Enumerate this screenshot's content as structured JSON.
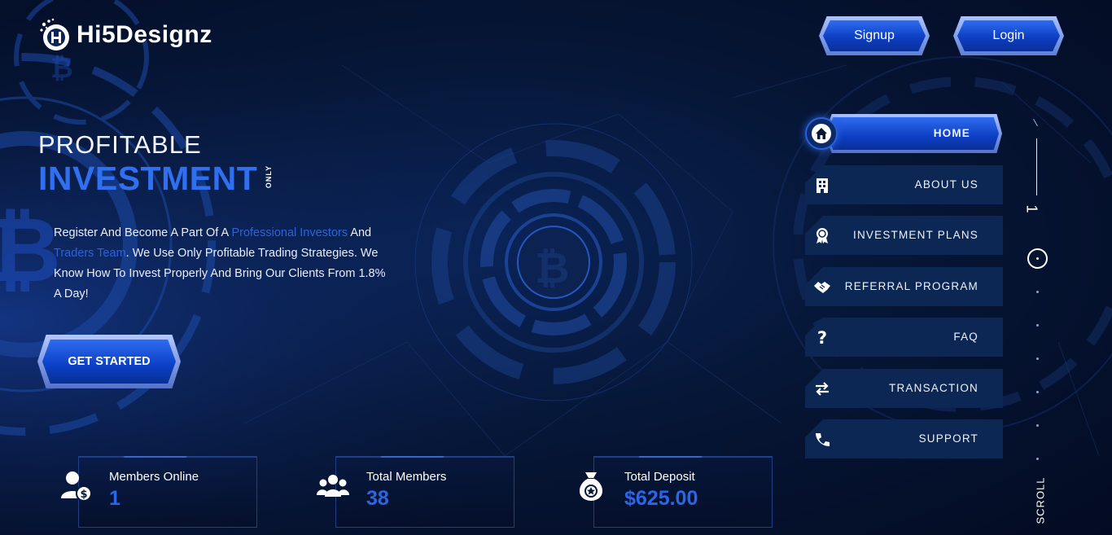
{
  "brand": {
    "name": "Hi5Designz",
    "logo_icon": "h5-logo-icon"
  },
  "header": {
    "signup_label": "Signup",
    "login_label": "Login"
  },
  "hero": {
    "line1": "PROFITABLE",
    "line2": "INVESTMENT",
    "tag": "ONLY",
    "desc_1": "Register And Become A Part Of A ",
    "desc_hl1": "Professional Investors",
    "desc_2": " And ",
    "desc_hl2": "Traders Team",
    "desc_3": ". We Use Only Profitable Trading Strategies. We Know How To Invest Properly And Bring Our Clients From 1.8% A Day!",
    "cta_label": "GET STARTED"
  },
  "stats": [
    {
      "label": "Members Online",
      "value": "1",
      "icon": "user-dollar-icon"
    },
    {
      "label": "Total Members",
      "value": "38",
      "icon": "users-group-icon"
    },
    {
      "label": "Total Deposit",
      "value": "$625.00",
      "icon": "money-bag-icon"
    }
  ],
  "nav": [
    {
      "label": "HOME",
      "icon": "home-icon"
    },
    {
      "label": "ABOUT US",
      "icon": "building-icon"
    },
    {
      "label": "INVESTMENT PLANS",
      "icon": "award-icon"
    },
    {
      "label": "REFERRAL PROGRAM",
      "icon": "handshake-icon"
    },
    {
      "label": "FAQ",
      "icon": "question-icon"
    },
    {
      "label": "TRANSACTION",
      "icon": "exchange-icon"
    },
    {
      "label": "SUPPORT",
      "icon": "support-icon"
    }
  ],
  "scroll": {
    "section_number": "1",
    "label": "SCROLL"
  },
  "colors": {
    "accent": "#2f6ff0",
    "nav_bg": "#0c2753",
    "page_bg": "#061636"
  }
}
